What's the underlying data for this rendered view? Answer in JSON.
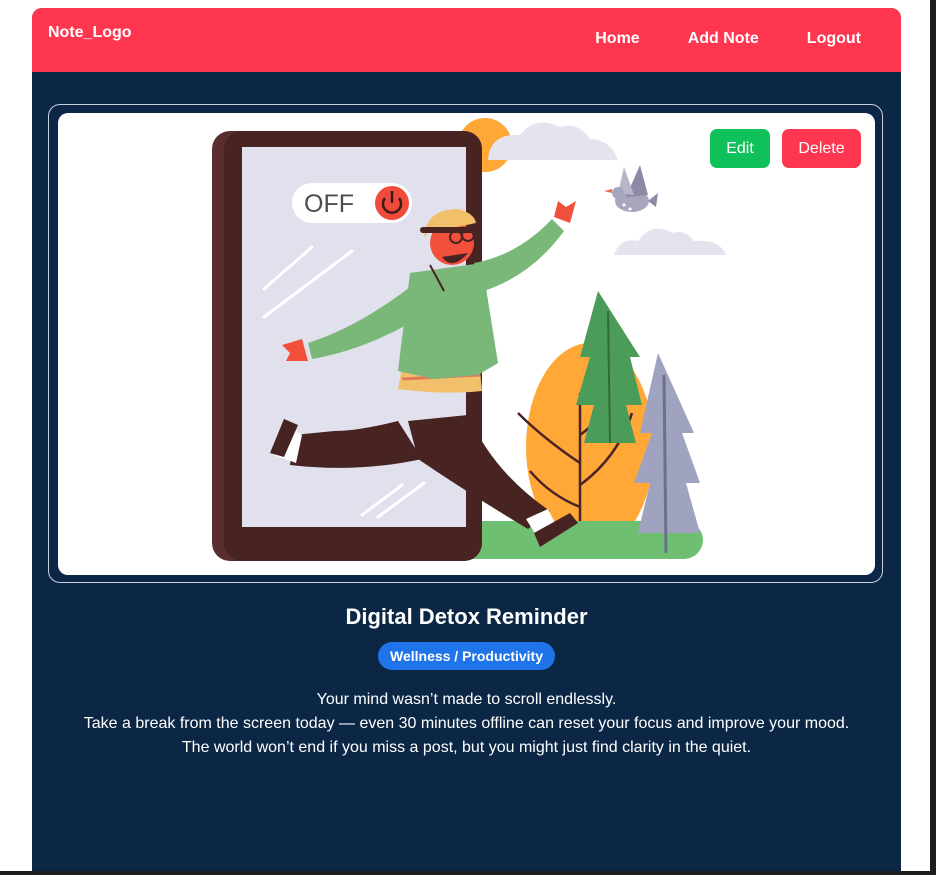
{
  "navbar": {
    "logo": "Note_Logo",
    "links": [
      "Home",
      "Add Note",
      "Logout"
    ],
    "background": "#ff364f"
  },
  "note": {
    "title": "Digital Detox Reminder",
    "category": "Wellness / Productivity",
    "body_lines": [
      "Your mind wasn’t made to scroll endlessly.",
      "Take a break from the screen today — even 30 minutes offline can reset your focus and improve your mood.",
      "The world won’t end if you miss a post, but you might just find clarity in the quiet."
    ],
    "actions": {
      "edit_label": "Edit",
      "delete_label": "Delete"
    },
    "illustration": {
      "screen_toggle_label": "OFF",
      "icons": [
        "power-icon",
        "bird-icon",
        "sun-icon",
        "cloud-icon",
        "tree-icon",
        "bush-icon"
      ]
    }
  },
  "colors": {
    "page_background": "#0b2745",
    "accent_red": "#ff364f",
    "edit_green": "#10c05a",
    "badge_blue": "#1e74e8"
  }
}
